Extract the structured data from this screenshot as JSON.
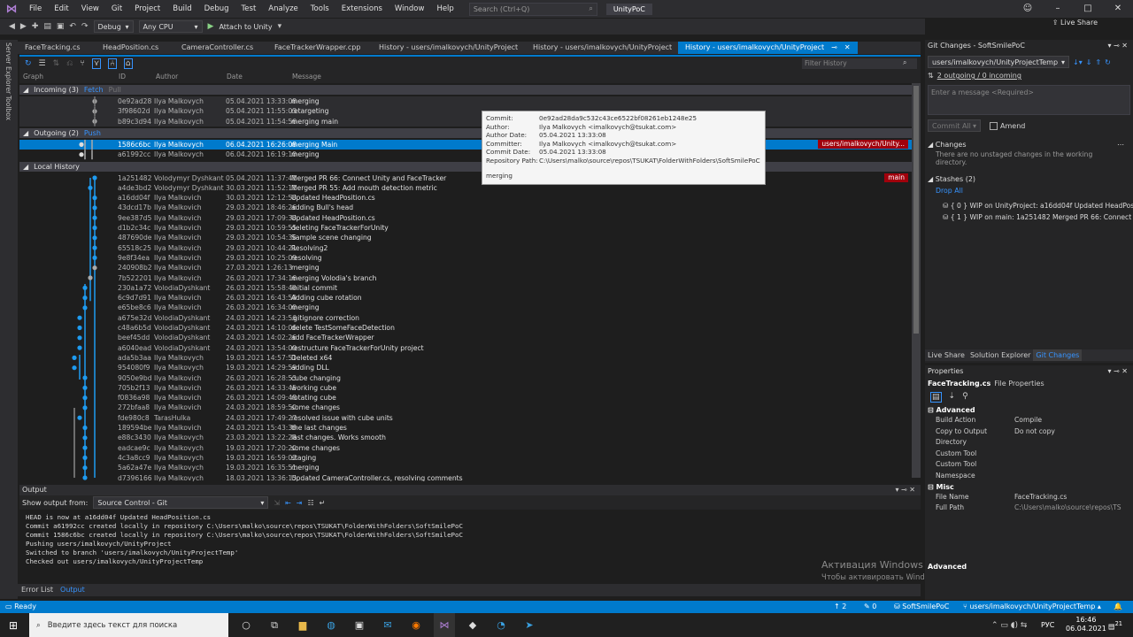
{
  "menu": {
    "items": [
      "File",
      "Edit",
      "View",
      "Git",
      "Project",
      "Build",
      "Debug",
      "Test",
      "Analyze",
      "Tools",
      "Extensions",
      "Window",
      "Help"
    ],
    "search_placeholder": "Search (Ctrl+Q)",
    "solution": "UnityPoC",
    "live_share": "Live Share"
  },
  "toolbar": {
    "config": "Debug",
    "platform": "Any CPU",
    "attach": "Attach to Unity"
  },
  "side_labels": [
    "Server Explorer",
    "Toolbox"
  ],
  "tabs": [
    "FaceTracking.cs",
    "HeadPosition.cs",
    "CameraController.cs",
    "FaceTrackerWrapper.cpp",
    "History - users/imalkovych/UnityProject",
    "History - users/imalkovych/UnityProject",
    "History - users/imalkovych/UnityProject"
  ],
  "history": {
    "filter_placeholder": "Filter History",
    "columns": [
      "Graph",
      "ID",
      "Author",
      "Date",
      "Message"
    ],
    "incoming": {
      "label": "Incoming (3)",
      "fetch": "Fetch",
      "pull": "Pull"
    },
    "outgoing": {
      "label": "Outgoing (2)",
      "push": "Push"
    },
    "local": {
      "label": "Local History"
    },
    "incoming_rows": [
      {
        "id": "0e92ad28",
        "author": "Ilya Malkovych",
        "date": "05.04.2021 13:33:08",
        "msg": "merging"
      },
      {
        "id": "3f98602d",
        "author": "Ilya Malkovych",
        "date": "05.04.2021 11:55:03",
        "msg": "retargeting"
      },
      {
        "id": "b89c3d94",
        "author": "Ilya Malkovych",
        "date": "05.04.2021 11:54:56",
        "msg": "merging main"
      }
    ],
    "outgoing_rows": [
      {
        "id": "1586c6bc",
        "author": "Ilya Malkovych",
        "date": "06.04.2021 16:26:08",
        "msg": "merging Main",
        "branch": "users/imalkovych/Unity..."
      },
      {
        "id": "a61992cc",
        "author": "Ilya Malkovych",
        "date": "06.04.2021 16:19:10",
        "msg": "merging"
      }
    ],
    "local_branch_tag": "main",
    "local_rows": [
      {
        "id": "1a251482",
        "author": "Volodymyr Dyshkant",
        "date": "05.04.2021 11:37:41",
        "msg": "Merged PR 66: Connect Unity and FaceTracker"
      },
      {
        "id": "a4de3bd2",
        "author": "Volodymyr Dyshkant",
        "date": "30.03.2021 11:52:11",
        "msg": "Merged PR 55: Add mouth detection metric"
      },
      {
        "id": "a16dd04f",
        "author": "Ilya Malkovich",
        "date": "30.03.2021 12:12:58",
        "msg": "Updated HeadPosition.cs"
      },
      {
        "id": "43dcd17b",
        "author": "Ilya Malkovich",
        "date": "29.03.2021 18:46:26",
        "msg": "adding Bull's head"
      },
      {
        "id": "9ee387d5",
        "author": "Ilya Malkovich",
        "date": "29.03.2021 17:09:38",
        "msg": "Updated HeadPosition.cs"
      },
      {
        "id": "d1b2c34c",
        "author": "Ilya Malkovich",
        "date": "29.03.2021 10:59:55",
        "msg": "deleting FaceTrackerForUnity"
      },
      {
        "id": "487690de",
        "author": "Ilya Malkovich",
        "date": "29.03.2021 10:54:36",
        "msg": "Sample scene changing"
      },
      {
        "id": "65518c25",
        "author": "Ilya Malkovich",
        "date": "29.03.2021 10:44:21",
        "msg": "Resolving2"
      },
      {
        "id": "9e8f34ea",
        "author": "Ilya Malkovich",
        "date": "29.03.2021 10:25:09",
        "msg": "resolving"
      },
      {
        "id": "240908b2",
        "author": "Ilya Malkovich",
        "date": "27.03.2021 1:26:13",
        "msg": "merging"
      },
      {
        "id": "7b522201",
        "author": "Ilya Malkovich",
        "date": "26.03.2021 17:34:16",
        "msg": "merging Volodia's branch"
      },
      {
        "id": "230a1a72",
        "author": "VolodiaDyshkant",
        "date": "26.03.2021 15:58:40",
        "msg": "initial commit"
      },
      {
        "id": "6c9d7d91",
        "author": "Ilya Malkovich",
        "date": "26.03.2021 16:43:59",
        "msg": "Adding cube rotation"
      },
      {
        "id": "e65be8c6",
        "author": "Ilya Malkovich",
        "date": "26.03.2021 16:34:00",
        "msg": "merging"
      },
      {
        "id": "a675e32d",
        "author": "VolodiaDyshkant",
        "date": "24.03.2021 14:23:56",
        "msg": ".gitignore correction"
      },
      {
        "id": "c48a6b5d",
        "author": "VolodiaDyshkant",
        "date": "24.03.2021 14:10:06",
        "msg": "delete TestSomeFaceDetection"
      },
      {
        "id": "beef45dd",
        "author": "VolodiaDyshkant",
        "date": "24.03.2021 14:02:26",
        "msg": "add FaceTrackerWrapper"
      },
      {
        "id": "a6040ead",
        "author": "VolodiaDyshkant",
        "date": "24.03.2021 13:54:00",
        "msg": "restructure FaceTrackerForUnity project"
      },
      {
        "id": "ada5b3aa",
        "author": "Ilya Malkovych",
        "date": "19.03.2021 14:57:51",
        "msg": "Deleted x64"
      },
      {
        "id": "954080f9",
        "author": "Ilya Malkovych",
        "date": "19.03.2021 14:29:59",
        "msg": "adding DLL"
      },
      {
        "id": "9050e9bd",
        "author": "Ilya Malkovich",
        "date": "26.03.2021 16:28:53",
        "msg": "cube changing"
      },
      {
        "id": "705b2f13",
        "author": "Ilya Malkovich",
        "date": "26.03.2021 14:33:45",
        "msg": "working cube"
      },
      {
        "id": "f0836a98",
        "author": "Ilya Malkovich",
        "date": "26.03.2021 14:09:48",
        "msg": "rotating cube"
      },
      {
        "id": "272bfaa8",
        "author": "Ilya Malkovich",
        "date": "24.03.2021 18:59:50",
        "msg": "some changes"
      },
      {
        "id": "fde980c8",
        "author": "TarasHulka",
        "date": "24.03.2021 17:49:27",
        "msg": "resolved issue with cube units"
      },
      {
        "id": "189594be",
        "author": "Ilya Malkovich",
        "date": "24.03.2021 15:43:36",
        "msg": "the last changes"
      },
      {
        "id": "e88c3430",
        "author": "Ilya Malkovych",
        "date": "23.03.2021 13:22:28",
        "msg": "last changes. Works smooth"
      },
      {
        "id": "eadcae9c",
        "author": "Ilya Malkovych",
        "date": "19.03.2021 17:20:20",
        "msg": "some changes"
      },
      {
        "id": "4c3a8cc9",
        "author": "Ilya Malkovych",
        "date": "19.03.2021 16:59:03",
        "msg": "staging"
      },
      {
        "id": "5a62a47e",
        "author": "Ilya Malkovych",
        "date": "19.03.2021 16:35:51",
        "msg": "merging"
      },
      {
        "id": "d7396166",
        "author": "Ilya Malkovych",
        "date": "18.03.2021 13:36:15",
        "msg": "Updated CameraController.cs, resolving comments"
      }
    ]
  },
  "tooltip": {
    "rows": [
      {
        "k": "Commit:",
        "v": "0e92ad28da9c532c43ce6522bf08261eb1248e25"
      },
      {
        "k": "Author:",
        "v": "Ilya Malkovych <imalkovych@tsukat.com>"
      },
      {
        "k": "Author Date:",
        "v": "05.04.2021 13:33:08"
      },
      {
        "k": "Committer:",
        "v": "Ilya Malkovych <imalkovych@tsukat.com>"
      },
      {
        "k": "Commit Date:",
        "v": "05.04.2021 13:33:08"
      },
      {
        "k": "Repository Path:",
        "v": "C:\\Users\\malko\\source\\repos\\TSUKAT\\FolderWithFolders\\SoftSmilePoC"
      }
    ],
    "message": "merging"
  },
  "output": {
    "title": "Output",
    "show_from_label": "Show output from:",
    "source": "Source Control - Git",
    "lines": [
      "HEAD is now at a16dd04f Updated HeadPosition.cs",
      "Commit a61992cc created locally in repository C:\\Users\\malko\\source\\repos\\TSUKAT\\FolderWithFolders\\SoftSmilePoC",
      "Commit 1586c6bc created locally in repository C:\\Users\\malko\\source\\repos\\TSUKAT\\FolderWithFolders\\SoftSmilePoC",
      "Pushing users/imalkovych/UnityProject",
      "Switched to branch 'users/imalkovych/UnityProjectTemp'",
      "Checked out users/imalkovych/UnityProjectTemp"
    ]
  },
  "bottom_tabs": [
    "Error List",
    "Output"
  ],
  "git_changes": {
    "title": "Git Changes - SoftSmilePoC",
    "branch": "users/imalkovych/UnityProjectTemp",
    "outgoing": "2 outgoing / 0 incoming",
    "message_placeholder": "Enter a message <Required>",
    "commit_all": "Commit All",
    "amend": "Amend",
    "changes_header": "Changes",
    "changes_text": "There are no unstaged changes in the working directory.",
    "stashes_header": "Stashes (2)",
    "drop_all": "Drop All",
    "stashes": [
      "{ 0 } WIP on UnityProject: a16dd04f Updated HeadPosit",
      "{ 1 } WIP on main: 1a251482 Merged PR 66: Connect Ur"
    ],
    "panel_tabs": [
      "Live Share",
      "Solution Explorer",
      "Git Changes"
    ]
  },
  "properties": {
    "title": "Properties",
    "file": "FaceTracking.cs",
    "file_type": "File Properties",
    "advanced_header": "Advanced",
    "advanced": [
      {
        "k": "Build Action",
        "v": "Compile"
      },
      {
        "k": "Copy to Output Directory",
        "v": "Do not copy"
      },
      {
        "k": "Custom Tool",
        "v": ""
      },
      {
        "k": "Custom Tool Namespace",
        "v": ""
      }
    ],
    "misc_header": "Misc",
    "misc": [
      {
        "k": "File Name",
        "v": "FaceTracking.cs"
      },
      {
        "k": "Full Path",
        "v": "C:\\Users\\malko\\source\\repos\\TS"
      }
    ],
    "desc_title": "Advanced"
  },
  "watermark": {
    "line1": "Активация Windows",
    "line2": "Чтобы активировать Windows, перейдите в раздел \"Параметры\"."
  },
  "statusbar": {
    "ready": "Ready",
    "up": "2",
    "pencil": "0",
    "repo": "SoftSmilePoC",
    "branch": "users/imalkovych/UnityProjectTemp"
  },
  "taskbar": {
    "search": "Введите здесь текст для поиска",
    "lang": "РУС",
    "time": "16:46",
    "date": "06.04.2021",
    "notif": "21"
  },
  "colors": {
    "accent": "#007acc",
    "branch_tag": "#a1000c",
    "graph": "#1e9bf0"
  }
}
